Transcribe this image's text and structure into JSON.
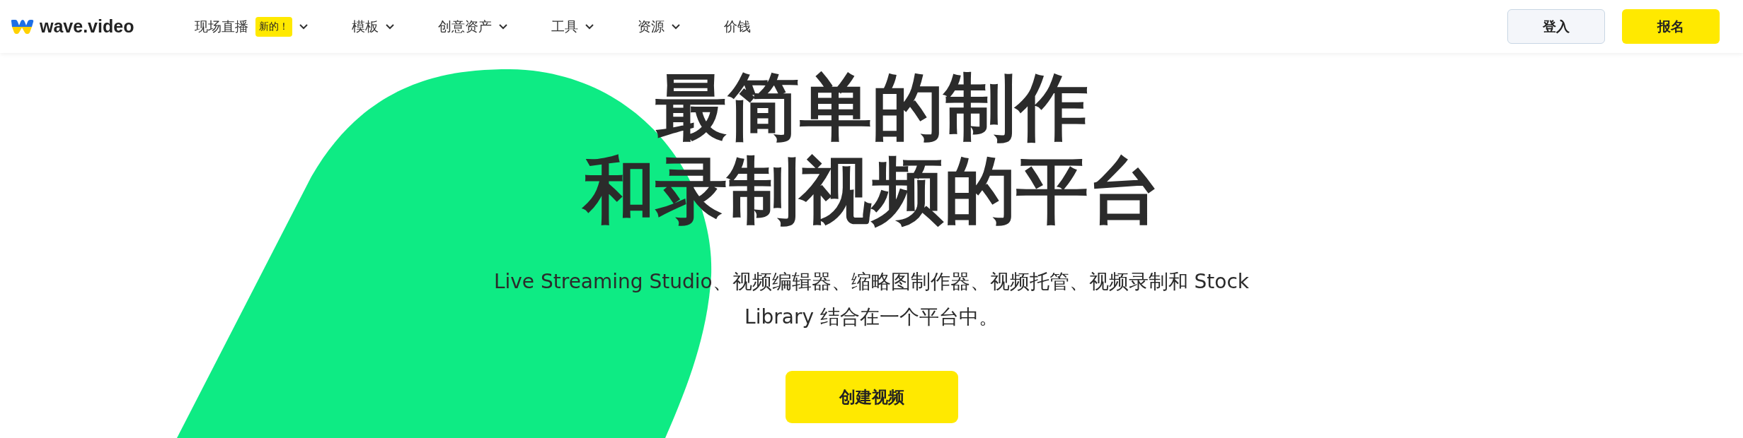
{
  "header": {
    "logo": "wave.video",
    "nav": [
      {
        "label": "现场直播",
        "badge": "新的！",
        "dropdown": true
      },
      {
        "label": "模板",
        "dropdown": true
      },
      {
        "label": "创意资产",
        "dropdown": true
      },
      {
        "label": "工具",
        "dropdown": true
      },
      {
        "label": "资源",
        "dropdown": true
      },
      {
        "label": "价钱",
        "dropdown": false
      }
    ],
    "buttons": [
      {
        "label": "登入",
        "kind": "secondary"
      },
      {
        "label": "报名",
        "kind": "primary"
      }
    ]
  },
  "hero": {
    "title_lines": [
      "最简单的制作",
      "和录制视频的平台"
    ],
    "subtitle": "Live Streaming Studio、视频编辑器、缩略图制作器、视频托管、视频录制和 Stock Library 结合在一个平台中。",
    "cta": "创建视频"
  }
}
